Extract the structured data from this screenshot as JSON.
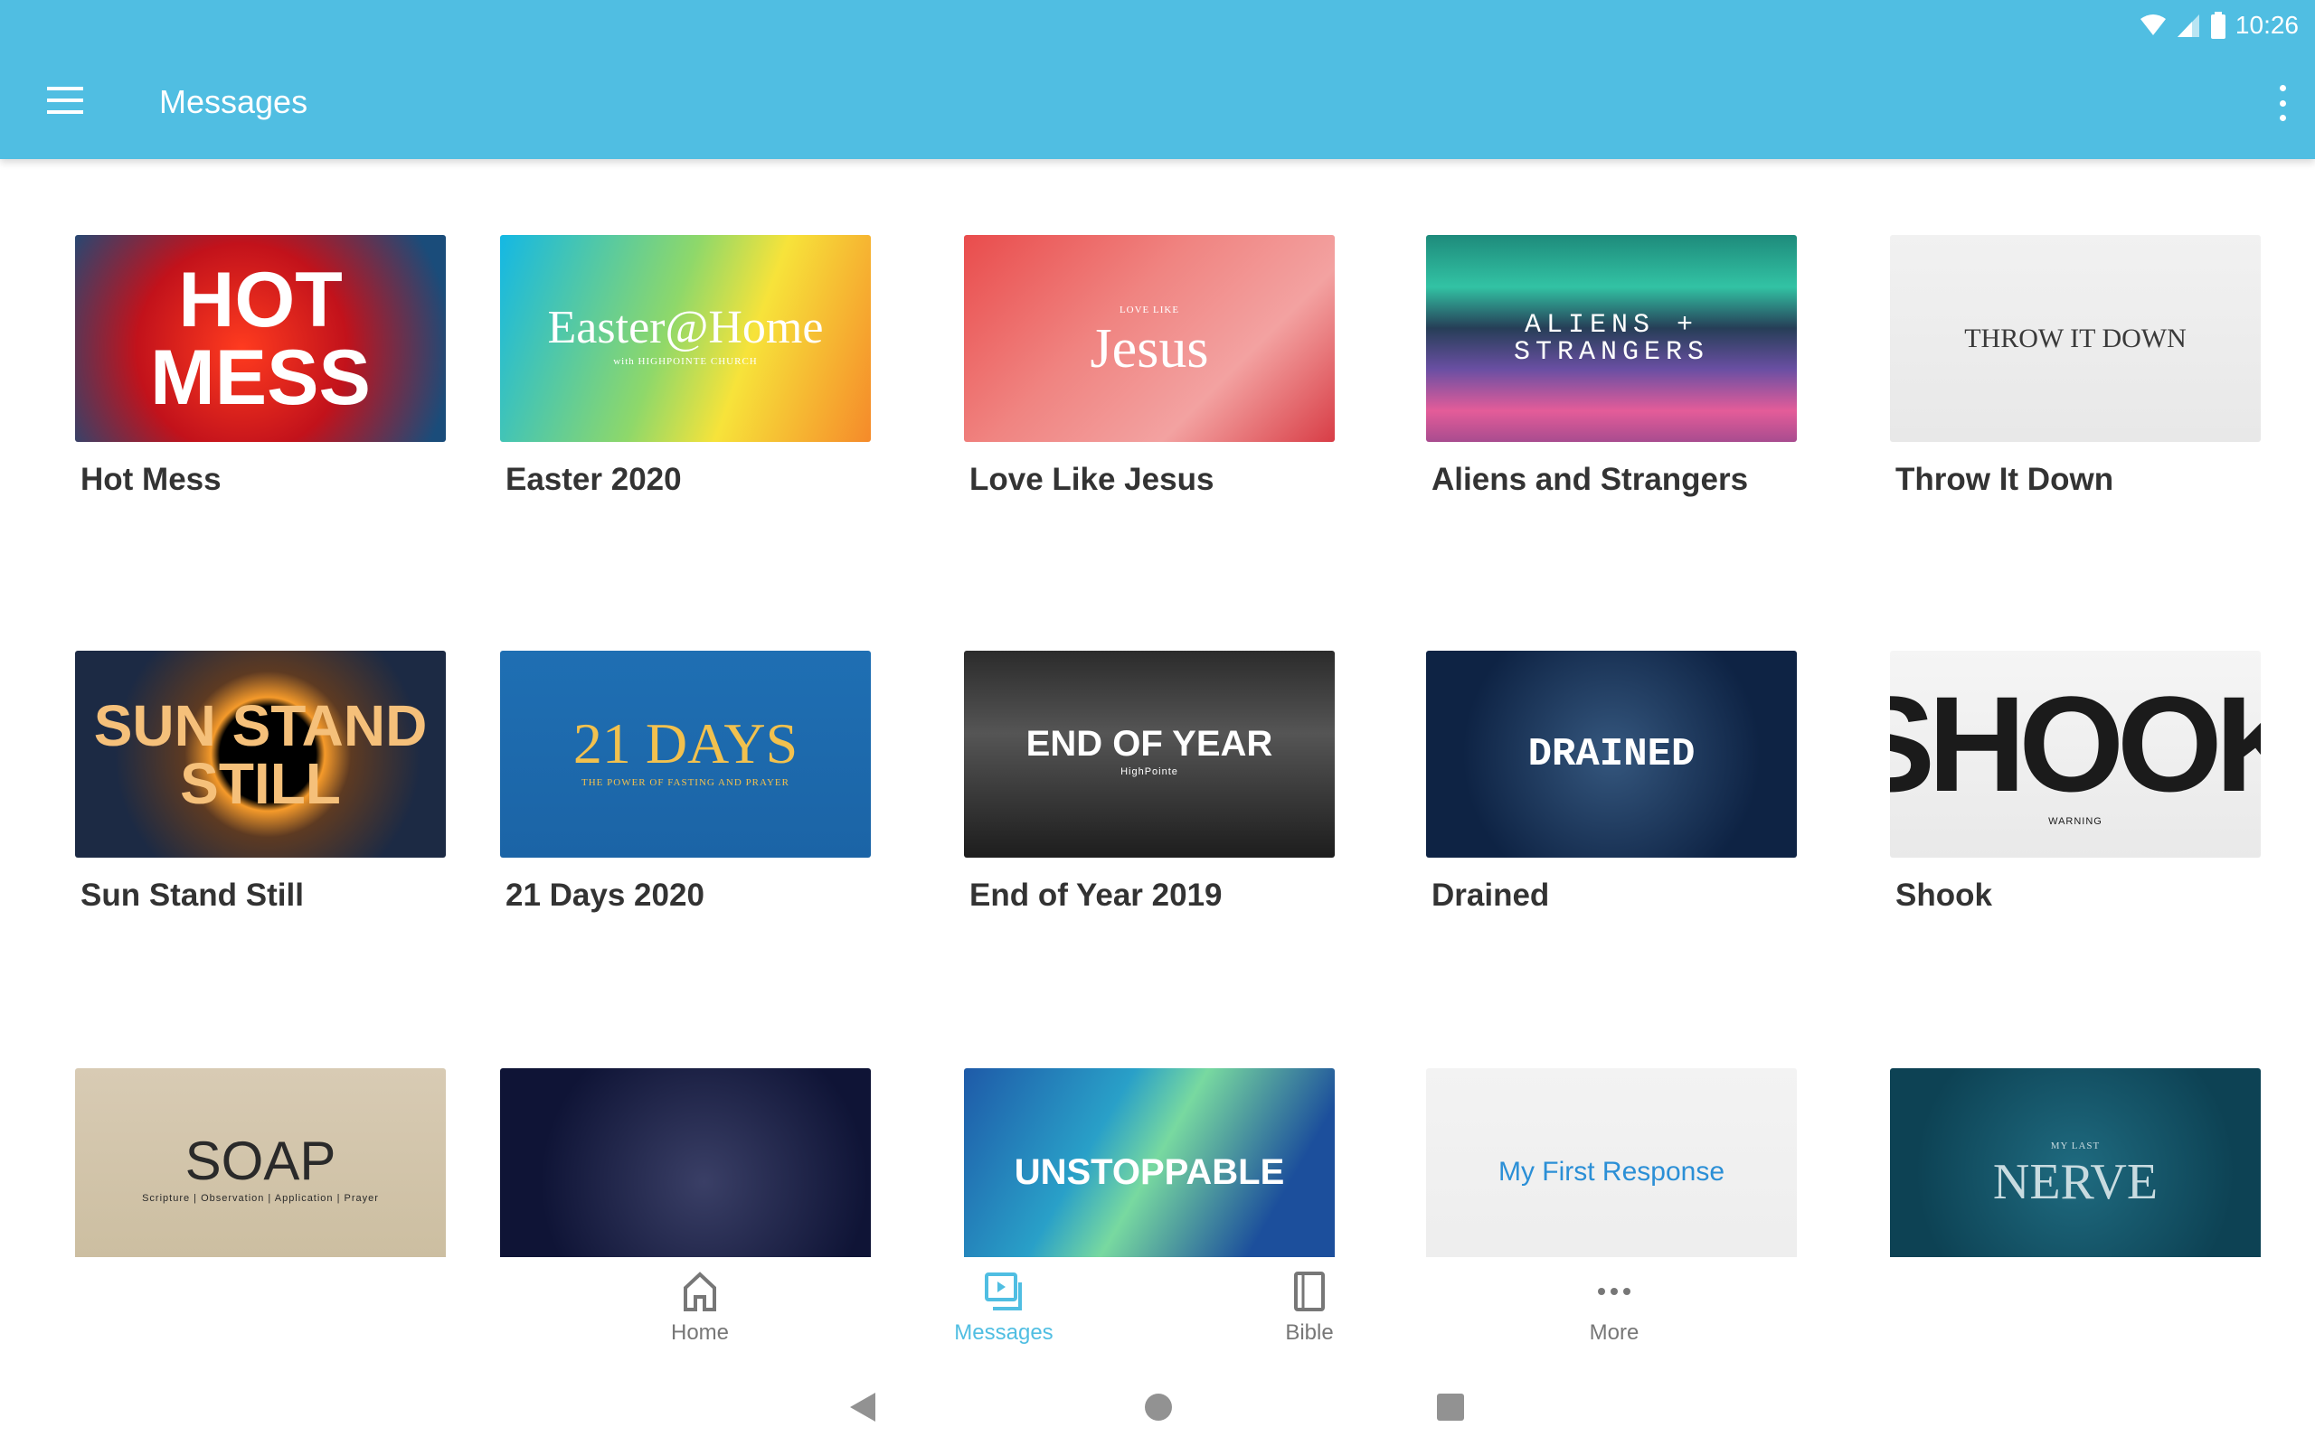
{
  "status_bar": {
    "time": "10:26",
    "icons": [
      "wifi-icon",
      "signal-icon",
      "battery-icon"
    ]
  },
  "header": {
    "title": "Messages",
    "menu_icon": "hamburger-icon",
    "overflow_icon": "more-vert-icon",
    "color": "#50bee2"
  },
  "messages": [
    {
      "title": "Hot Mess",
      "art": "HOT MESS"
    },
    {
      "title": "Easter 2020",
      "art": "Easter@Home",
      "art_sub": "with HIGHPOINTE CHURCH"
    },
    {
      "title": "Love Like Jesus",
      "art": "Jesus",
      "art_sub": "LOVE LIKE"
    },
    {
      "title": "Aliens and Strangers",
      "art": "ALIENS + STRANGERS"
    },
    {
      "title": "Throw It Down",
      "art": "THROW IT DOWN"
    },
    {
      "title": "Sun Stand Still",
      "art": "SUN STAND STILL"
    },
    {
      "title": "21 Days 2020",
      "art": "21 DAYS",
      "art_sub": "THE POWER OF FASTING AND PRAYER"
    },
    {
      "title": "End of Year 2019",
      "art": "END OF YEAR",
      "art_sub": "HighPointe"
    },
    {
      "title": "Drained",
      "art": "DRAINED"
    },
    {
      "title": "Shook",
      "art": "SHOOK",
      "art_sub": "WARNING"
    },
    {
      "title": "",
      "art": "SOAP",
      "art_sub": "Scripture | Observation | Application | Prayer"
    },
    {
      "title": "",
      "art": ""
    },
    {
      "title": "",
      "art": "UNSTOPPABLE"
    },
    {
      "title": "",
      "art": "My First Response"
    },
    {
      "title": "",
      "art": "NERVE",
      "art_sub": "MY LAST"
    }
  ],
  "bottom_nav": {
    "items": [
      {
        "label": "Home",
        "icon": "home-icon"
      },
      {
        "label": "Messages",
        "icon": "messages-icon",
        "active": true
      },
      {
        "label": "Bible",
        "icon": "bible-icon"
      },
      {
        "label": "More",
        "icon": "more-horiz-icon"
      }
    ]
  },
  "system_nav": [
    "back-icon",
    "home-circle-icon",
    "recents-icon"
  ]
}
